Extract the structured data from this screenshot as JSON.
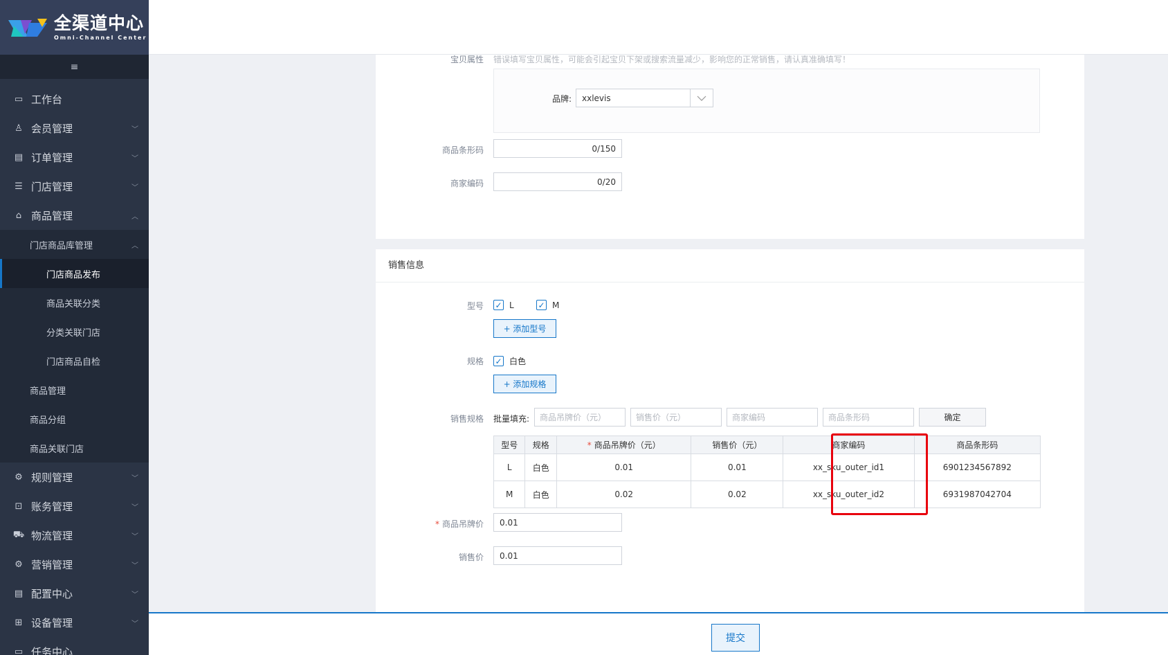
{
  "app": {
    "logo_main": "全渠道中心",
    "logo_sub": "Omni-Channel Center",
    "collapse_icon": "≡"
  },
  "sidebar": {
    "items": [
      {
        "label": "工作台",
        "icon": "monitor-icon",
        "glyph": "▭"
      },
      {
        "label": "会员管理",
        "icon": "members-icon",
        "glyph": "♙",
        "chevron": "﹀"
      },
      {
        "label": "订单管理",
        "icon": "order-icon",
        "glyph": "▤",
        "chevron": "﹀"
      },
      {
        "label": "门店管理",
        "icon": "list-icon",
        "glyph": "☰",
        "chevron": "﹀"
      },
      {
        "label": "商品管理",
        "icon": "bag-icon",
        "glyph": "⌂",
        "chevron": "︿"
      }
    ],
    "goods_sub": {
      "store_lib": {
        "label": "门店商品库管理",
        "chevron": "︿"
      },
      "store_lib_children": [
        "门店商品发布",
        "商品关联分类",
        "分类关联门店",
        "门店商品自检"
      ],
      "others": [
        "商品管理",
        "商品分组",
        "商品关联门店"
      ]
    },
    "items_after": [
      {
        "label": "规则管理",
        "icon": "rules-icon",
        "glyph": "⚙",
        "chevron": "﹀"
      },
      {
        "label": "账务管理",
        "icon": "finance-icon",
        "glyph": "⊡",
        "chevron": "﹀"
      },
      {
        "label": "物流管理",
        "icon": "truck-icon",
        "glyph": "⛟",
        "chevron": "﹀"
      },
      {
        "label": "营销管理",
        "icon": "marketing-icon",
        "glyph": "⚙",
        "chevron": "﹀"
      },
      {
        "label": "配置中心",
        "icon": "config-icon",
        "glyph": "▤",
        "chevron": "﹀"
      },
      {
        "label": "设备管理",
        "icon": "device-icon",
        "glyph": "⊞",
        "chevron": "﹀"
      },
      {
        "label": "任务中心",
        "icon": "task-icon",
        "glyph": "▭",
        "chevron": ""
      }
    ]
  },
  "form": {
    "attr_label": "宝贝属性",
    "attr_hint": "错误填写宝贝属性，可能会引起宝贝下架或搜索流量减少，影响您的正常销售，请认真准确填写！",
    "brand_label": "品牌:",
    "brand_value": "xxlevis",
    "barcode_label": "商品条形码",
    "barcode_count": "0/150",
    "outer_code_label": "商家编码",
    "outer_code_count": "0/20"
  },
  "sales": {
    "section_title": "销售信息",
    "model_label": "型号",
    "models": [
      "L",
      "M"
    ],
    "add_model": "+ 添加型号",
    "spec_label": "规格",
    "specs": [
      "白色"
    ],
    "add_spec": "+ 添加规格",
    "sale_spec_label": "销售规格",
    "batch_label": "批量填充:",
    "batch_placeholders": [
      "商品吊牌价（元）",
      "销售价（元）",
      "商家编码",
      "商品条形码"
    ],
    "confirm": "确定",
    "table": {
      "headers": [
        "型号",
        "规格",
        "商品吊牌价（元）",
        "销售价（元）",
        "商家编码",
        "商品条形码"
      ],
      "required_mark": "*",
      "rows": [
        [
          "L",
          "白色",
          "0.01",
          "0.01",
          "xx_sku_outer_id1",
          "6901234567892"
        ],
        [
          "M",
          "白色",
          "0.02",
          "0.02",
          "xx_sku_outer_id2",
          "6931987042704"
        ]
      ]
    },
    "tag_price_label": "商品吊牌价",
    "tag_price_value": "0.01",
    "sale_price_label": "销售价",
    "sale_price_value": "0.01"
  },
  "footer": {
    "submit": "提交"
  },
  "colors": {
    "accent": "#1677c9",
    "sidebar_bg": "#2b3445",
    "highlight": "#e8000d"
  }
}
